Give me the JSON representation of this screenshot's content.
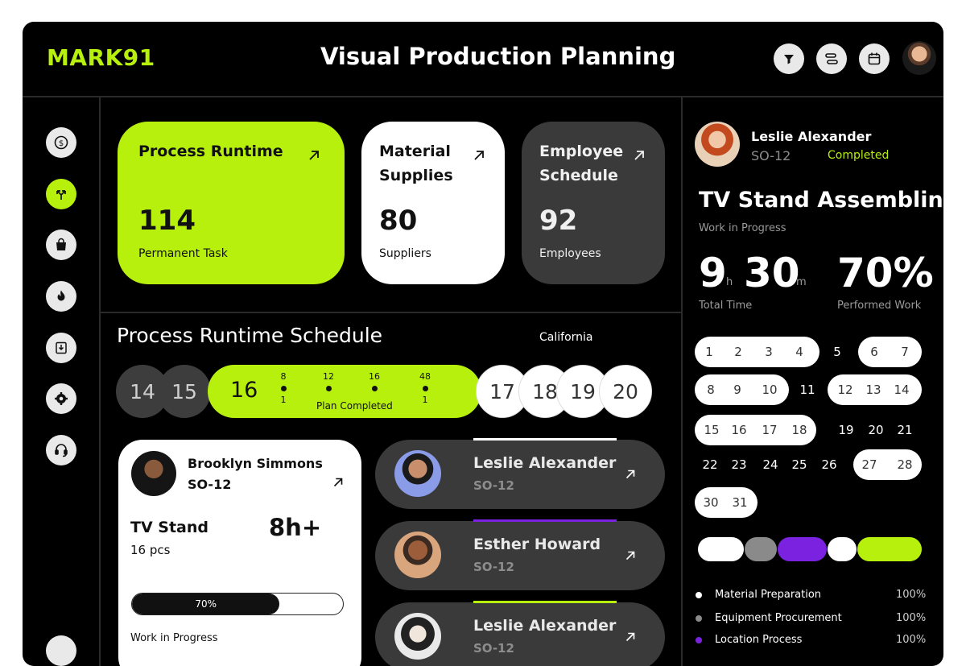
{
  "header": {
    "logo": "MARK91",
    "title": "Visual Production Planning"
  },
  "header_icons": [
    "filter-icon",
    "sliders-icon",
    "calendar-icon"
  ],
  "sidebar_icons": [
    "dollar-icon",
    "route-icon",
    "bag-icon",
    "fire-icon",
    "download-icon",
    "gear-icon",
    "headset-icon"
  ],
  "cards": [
    {
      "title": "Process Runtime",
      "value": "114",
      "sub": "Permanent Task"
    },
    {
      "title": "Material Supplies",
      "value": "80",
      "sub": "Suppliers"
    },
    {
      "title": "Employee Schedule",
      "value": "92",
      "sub": "Employees"
    }
  ],
  "schedule": {
    "title": "Process Runtime Schedule",
    "location": "California",
    "days_before": [
      "14",
      "15"
    ],
    "active_day": "16",
    "ticks": [
      {
        "top": "8",
        "bottom": "1"
      },
      {
        "top": "12",
        "bottom": ""
      },
      {
        "top": "16",
        "bottom": ""
      },
      {
        "top": "48",
        "bottom": "1"
      }
    ],
    "active_label": "Plan Completed",
    "days_after": [
      "17",
      "18",
      "19",
      "20"
    ]
  },
  "task_card": {
    "name": "Brooklyn Simmons",
    "code": "SO-12",
    "product": "TV Stand",
    "quantity": "16 pcs",
    "duration": "8h+",
    "progress_label": "70%",
    "progress": 0.7,
    "status": "Work in Progress"
  },
  "people": [
    {
      "name": "Leslie Alexander",
      "code": "SO-12",
      "accent": "#ffffff"
    },
    {
      "name": "Esther Howard",
      "code": "SO-12",
      "accent": "#7b22e0"
    },
    {
      "name": "Leslie Alexander",
      "code": "SO-12",
      "accent": "#b8f00e"
    }
  ],
  "detail": {
    "name": "Leslie Alexander",
    "code": "SO-12",
    "status": "Completed",
    "title": "TV Stand Assembling",
    "subtitle": "Work in Progress",
    "hours": "9",
    "hours_unit": "h",
    "minutes": "30",
    "minutes_unit": "m",
    "total_label": "Total Time",
    "percent": "70%",
    "percent_label": "Performed Work"
  },
  "calendar": {
    "days": [
      "1",
      "2",
      "3",
      "4",
      "5",
      "6",
      "7",
      "8",
      "9",
      "10",
      "11",
      "12",
      "13",
      "14",
      "15",
      "16",
      "17",
      "18",
      "19",
      "20",
      "21",
      "22",
      "23",
      "24",
      "25",
      "26",
      "27",
      "28",
      "30",
      "31"
    ]
  },
  "legend": [
    {
      "label": "Material Preparation",
      "value": "100%",
      "color": "#ffffff"
    },
    {
      "label": "Equipment Procurement",
      "value": "100%",
      "color": "#8a8a8a"
    },
    {
      "label": "Location Process",
      "value": "100%",
      "color": "#7b22e0"
    }
  ],
  "colors": {
    "accent": "#b8f00e",
    "purple": "#7b22e0",
    "gray": "#8a8a8a"
  }
}
